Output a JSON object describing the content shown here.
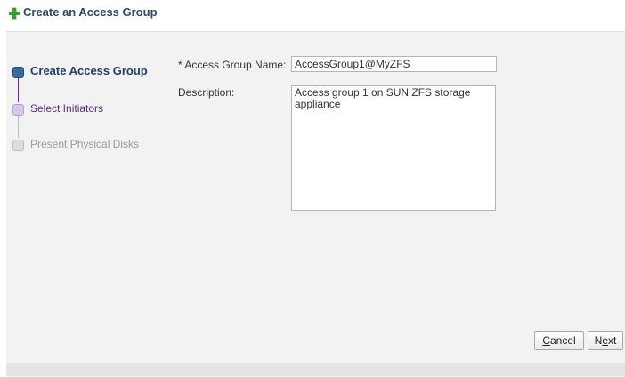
{
  "dialog": {
    "title": "Create an Access Group",
    "title_icon": "green-plus-icon"
  },
  "train": {
    "steps": [
      {
        "label": "Create Access Group",
        "state": "current"
      },
      {
        "label": "Select Initiators",
        "state": "next"
      },
      {
        "label": "Present Physical Disks",
        "state": "disabled"
      }
    ]
  },
  "form": {
    "name_label": "* Access Group Name:",
    "name_value": "AccessGroup1@MyZFS",
    "description_label": "Description:",
    "description_value": "Access group 1 on SUN ZFS storage appliance"
  },
  "buttons": {
    "cancel_label": "Cancel",
    "next_label": "Next"
  },
  "colors": {
    "title": "#2b4a6b",
    "current_step": "#1f3f66",
    "next_step": "#5a2d82",
    "disabled_step": "#9a9a9a",
    "panel": "#f2f2f2"
  }
}
